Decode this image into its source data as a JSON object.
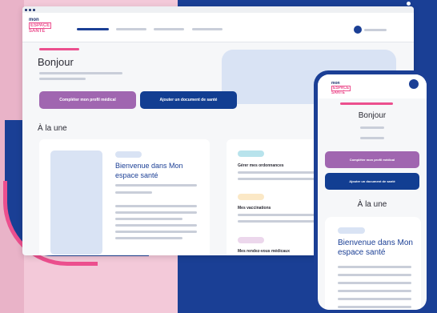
{
  "desktop": {
    "greeting": "Bonjour",
    "buttons": {
      "complete_profile": "Compléter mon profil médical",
      "add_document": "Ajouter un document de santé"
    },
    "section_title": "À la une",
    "featured_card": {
      "title": "Bienvenue dans Mon espace santé"
    },
    "side_items": [
      {
        "label": "Gérer mes ordonnances",
        "tag_color": "#b8e3ec"
      },
      {
        "label": "Mes vaccinations",
        "tag_color": "#fbe8c6"
      },
      {
        "label": "Mes rendez-vous médicaux",
        "tag_color": "#ecd7ec"
      }
    ]
  },
  "mobile": {
    "greeting": "Bonjour",
    "buttons": {
      "complete_profile": "Compléter mon profil médical",
      "add_document": "Ajouter un document de santé"
    },
    "section_title": "À la une",
    "featured_card": {
      "title": "Bienvenue dans Mon espace santé"
    }
  },
  "logo": {
    "line1": "mon",
    "line2": "ESPACE",
    "line3": "SANTÉ"
  },
  "colors": {
    "navy": "#1b3f95",
    "pink": "#ec4f8e",
    "purple": "#a066b0",
    "placeholder": "#d9e3f4"
  },
  "icons": [
    "user-avatar-icon"
  ]
}
